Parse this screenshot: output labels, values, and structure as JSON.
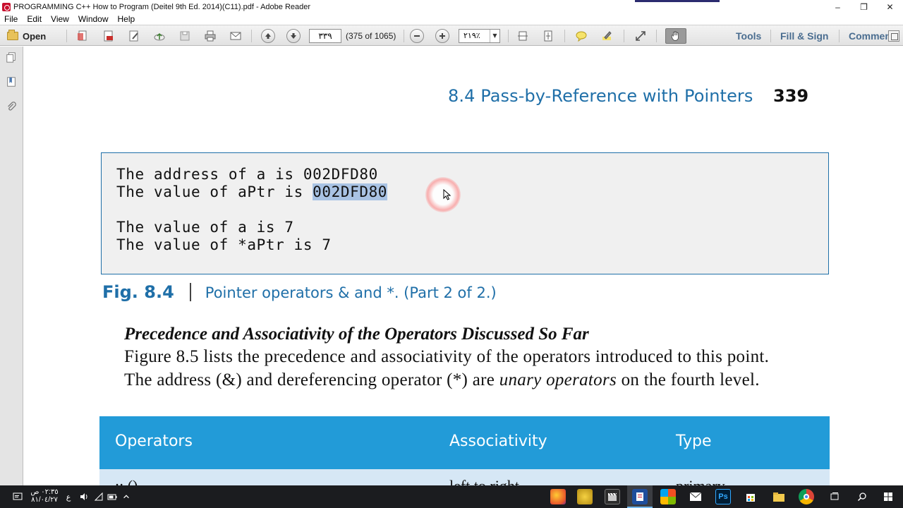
{
  "window": {
    "title": "PROGRAMMING C++ How to Program (Deitel 9th Ed. 2014)(C11).pdf - Adobe Reader",
    "controls": [
      "–",
      "❐",
      "✕"
    ]
  },
  "menu": [
    "File",
    "Edit",
    "View",
    "Window",
    "Help"
  ],
  "toolbar": {
    "open_label": "Open",
    "page_input": "٣٣٩",
    "page_count": "(375 of 1065)",
    "zoom": "٢١٩٪",
    "tools_label": "Tools",
    "fill_sign_label": "Fill & Sign",
    "comment_label": "Comment"
  },
  "document": {
    "section_title": "8.4   Pass-by-Reference with Pointers",
    "page_number": "339",
    "output_lines": {
      "line1": "The address of a is 002DFD80",
      "line2_prefix": "The value of aPtr is ",
      "line2_highlight": "002DFD80",
      "line3": "The value of a is 7",
      "line4": "The value of *aPtr is 7"
    },
    "figure_label": "Fig. 8.4",
    "figure_caption": "Pointer operators & and *. (Part 2 of 2.)",
    "subsection_heading": "Precedence and Associativity of the Operators Discussed So Far",
    "paragraph": {
      "line1": "Figure 8.5 lists the precedence and associativity of the operators introduced to this point.",
      "line2_a": "The address (&) and dereferencing operator (*) are ",
      "line2_em": "unary operators",
      "line2_b": " on the fourth level."
    },
    "table": {
      "headers": [
        "Operators",
        "Associativity",
        "Type"
      ],
      "first_row": [
        "::  ()",
        "left to right",
        "primary"
      ]
    }
  },
  "taskbar": {
    "time": "٠٢:٣٥ ص",
    "date": "٨١/٠٤/٢٧",
    "language": "ع",
    "colors": {
      "background": "#1b1c1f",
      "accent": "#76b9ed"
    }
  },
  "colors": {
    "heading_blue": "#1f6fa8",
    "table_header": "#229bd8",
    "table_row": "#d6e7f5",
    "selection": "#a9c3e4"
  }
}
